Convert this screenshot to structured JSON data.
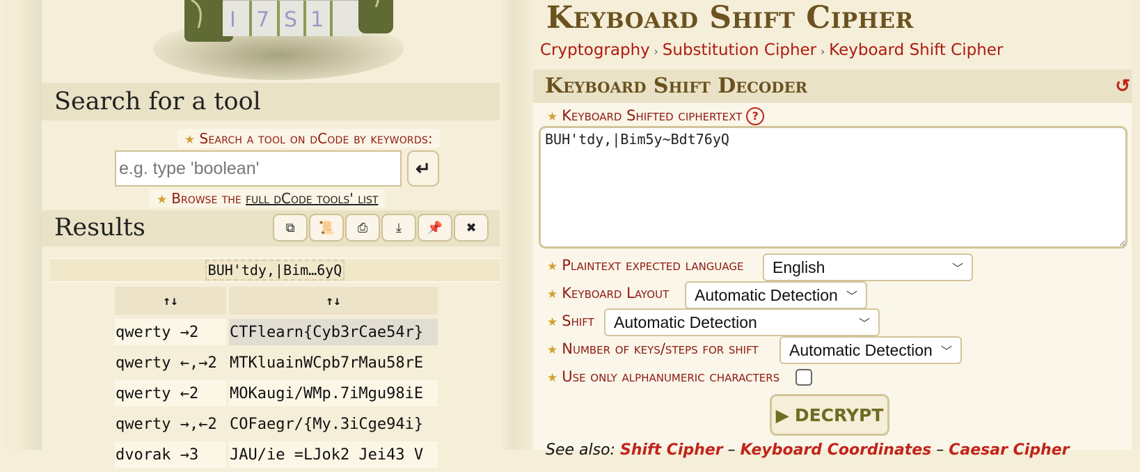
{
  "left": {
    "search_heading": "Search for a tool",
    "search_label": "Search a tool on dCode by keywords:",
    "search_placeholder": "e.g. type 'boolean'",
    "search_value": "",
    "browse_prefix": "Browse the",
    "browse_link": "full dCode tools' list",
    "results_heading": "Results",
    "result_title": "BUH'tdy,|Bim…6yQ",
    "table": {
      "headers": [
        "↑↓",
        "↑↓"
      ],
      "rows": [
        {
          "method": "qwerty →2",
          "text": "CTFlearn{Cyb3rCae54r}"
        },
        {
          "method": "qwerty ←,→2",
          "text": "MTKluainWCpb7rMau58rE"
        },
        {
          "method": "qwerty ←2",
          "text": "MOKaugi/WMp.7iMgu98iE"
        },
        {
          "method": "qwerty →,←2",
          "text": "COFaegr/{My.3iCge94i}"
        },
        {
          "method": "dvorak →3",
          "text": "JAU/ie =LJok2 Jei43 V"
        }
      ]
    }
  },
  "main": {
    "title": "Keyboard Shift Cipher",
    "breadcrumbs": [
      "Cryptography",
      "Substitution Cipher",
      "Keyboard Shift Cipher"
    ],
    "panel_title": "Keyboard Shift Decoder",
    "ciphertext_label": "Keyboard Shifted ciphertext",
    "ciphertext_value": "BUH'tdy,|Bim5y~Bdt76yQ",
    "language_label": "Plaintext expected language",
    "language_value": "English",
    "layout_label": "Keyboard Layout",
    "layout_value": "Automatic Detection",
    "shift_label": "Shift",
    "shift_value": "Automatic Detection",
    "steps_label": "Number of keys/steps for shift",
    "steps_value": "Automatic Detection",
    "alnum_label": "Use only alphanumeric characters",
    "alnum_checked": false,
    "decrypt_label": "DECRYPT",
    "see_also_label": "See also:",
    "see_also_links": [
      "Shift Cipher",
      "Keyboard Coordinates",
      "Caesar Cipher"
    ]
  },
  "colors": {
    "accent_red": "#ad1c14",
    "title_brown": "#6b5220",
    "star": "#d4a033",
    "background": "#f5eed8"
  }
}
